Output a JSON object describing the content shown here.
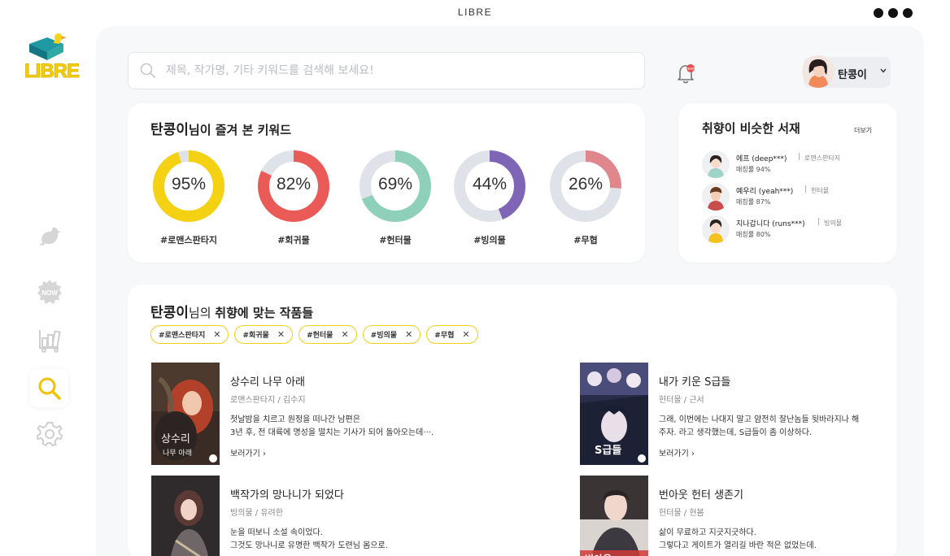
{
  "app": {
    "title": "LIBRE"
  },
  "logo": {
    "text": "LIBRE"
  },
  "search": {
    "placeholder": "제목, 작가명, 기타 키워드를 검색해 보세요!"
  },
  "profile": {
    "name": "탄콩이"
  },
  "keywords": {
    "title_name": "탄콩이",
    "title_rest": "님이 즐겨 본 키워드",
    "items": [
      {
        "percent": "95%",
        "value": 0.95,
        "label": "#로맨스판타지",
        "color": "#f4d213"
      },
      {
        "percent": "82%",
        "value": 0.82,
        "label": "#회귀물",
        "color": "#ea5a56"
      },
      {
        "percent": "69%",
        "value": 0.69,
        "label": "#헌터물",
        "color": "#8fd0bb"
      },
      {
        "percent": "44%",
        "value": 0.44,
        "label": "#빙의물",
        "color": "#7e65b6"
      },
      {
        "percent": "26%",
        "value": 0.26,
        "label": "#무협",
        "color": "#e0868d"
      }
    ]
  },
  "similar": {
    "title": "취향이 비슷한 서재",
    "more": "더보기",
    "users": [
      {
        "name": "에프 (deep***)",
        "genre": "로맨스판타지",
        "match": "매칭률 94%"
      },
      {
        "name": "예우리 (yeah***)",
        "genre": "헌터물",
        "match": "매칭률 87%"
      },
      {
        "name": "지나갑니다 (runs***)",
        "genre": "빙의물",
        "match": "매칭률 80%"
      }
    ]
  },
  "recommend": {
    "title_name": "탄콩이",
    "title_mid": "님의 ",
    "title_rest": "취향에 맞는 작품들",
    "chips": [
      "#로맨스판타지",
      "#회귀물",
      "#헌터물",
      "#빙의물",
      "#무협"
    ],
    "works": [
      {
        "title": "상수리 나무 아래",
        "meta": "로맨스판타지 / 김수지",
        "desc1": "첫날밤을 치르고 원정을 떠나간 남편은",
        "desc2": "3년 후, 전 대륙에 명성을 떨치는 기사가 되어 돌아오는데···.",
        "link": "보러가기"
      },
      {
        "title": "내가 키운 S급들",
        "meta": "헌터물 / 근서",
        "desc1": "그래, 이번에는 나대지 말고 얌전히 잘난놈들 뒷바라지나 해",
        "desc2": "주자. 라고 생각했는데, S급들이 좀 이상하다.",
        "link": "보러가기"
      },
      {
        "title": "백작가의 망나니가 되었다",
        "meta": "빙의물 / 유려한",
        "desc1": "눈을 떠보니 소설 속이었다.",
        "desc2": "그것도 망나니로 유명한 백작가 도련님 몸으로.",
        "link": ""
      },
      {
        "title": "번아웃 헌터 생존기",
        "meta": "헌터물 / 현봄",
        "desc1": "삶이 무료하고 지긋지긋하다.",
        "desc2": "그렇다고 게이트가 열리길 바란 적은 없었는데.",
        "link": ""
      }
    ]
  }
}
